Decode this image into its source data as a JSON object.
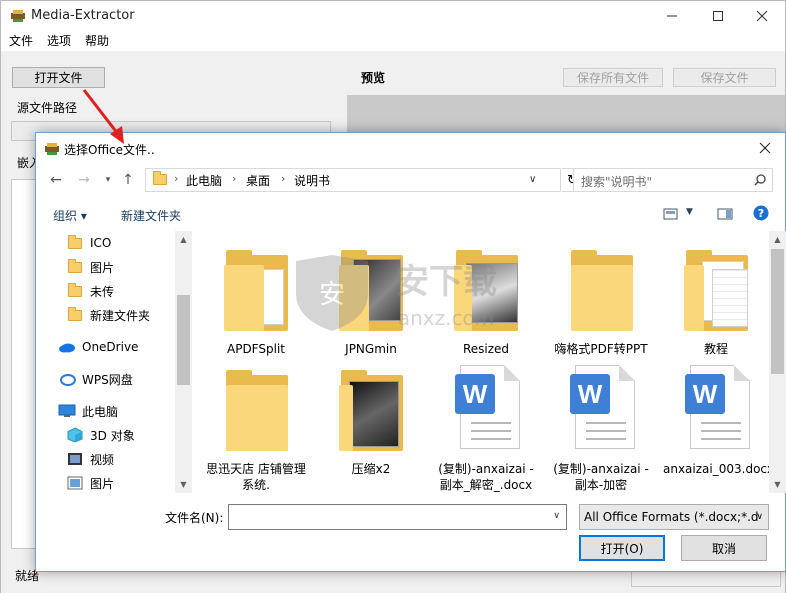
{
  "app": {
    "title": "Media-Extractor",
    "menu": [
      "文件",
      "选项",
      "帮助"
    ],
    "open_file_button": "打开文件",
    "source_path_label": "源文件路径",
    "embed_label": "嵌入",
    "preview_label": "预览",
    "save_all_button": "保存所有文件",
    "save_file_button": "保存文件",
    "status_text": "就绪"
  },
  "dialog": {
    "title": "选择Office文件..",
    "breadcrumb": [
      "此电脑",
      "桌面",
      "说明书"
    ],
    "search_placeholder": "搜索\"说明书\"",
    "organize_label": "组织 ▾",
    "new_folder_label": "新建文件夹",
    "nav_items": [
      {
        "label": "ICO",
        "icon": "folder-icon"
      },
      {
        "label": "图片",
        "icon": "folder-icon"
      },
      {
        "label": "未传",
        "icon": "folder-icon"
      },
      {
        "label": "新建文件夹",
        "icon": "folder-icon"
      },
      {
        "label": "OneDrive",
        "icon": "cloud-icon"
      },
      {
        "label": "WPS网盘",
        "icon": "wps-cloud-icon"
      },
      {
        "label": "此电脑",
        "icon": "computer-icon"
      },
      {
        "label": "3D 对象",
        "icon": "cube-icon"
      },
      {
        "label": "视频",
        "icon": "video-icon"
      },
      {
        "label": "图片",
        "icon": "pictures-icon"
      }
    ],
    "files": [
      {
        "label": "APDFSplit",
        "kind": "folder"
      },
      {
        "label": "JPNGmin",
        "kind": "folder"
      },
      {
        "label": "Resized",
        "kind": "folder"
      },
      {
        "label": "嗨格式PDF转PPT",
        "kind": "folder"
      },
      {
        "label": "教程",
        "kind": "folder"
      },
      {
        "label": "思迅天店 店铺管理系统.",
        "kind": "folder"
      },
      {
        "label": "压缩x2",
        "kind": "folder"
      },
      {
        "label": "(复制)-anxaizai -副本_解密_.docx",
        "kind": "docx"
      },
      {
        "label": "(复制)-anxaizai -副本-加密",
        "kind": "docx"
      },
      {
        "label": "anxaizai_003.docx",
        "kind": "docx"
      }
    ],
    "filename_label": "文件名(N):",
    "filename_value": "",
    "filetype_value": "All Office Formats (*.docx;*.d",
    "open_button": "打开(O)",
    "cancel_button": "取消"
  },
  "watermark_text": "anxz.com"
}
